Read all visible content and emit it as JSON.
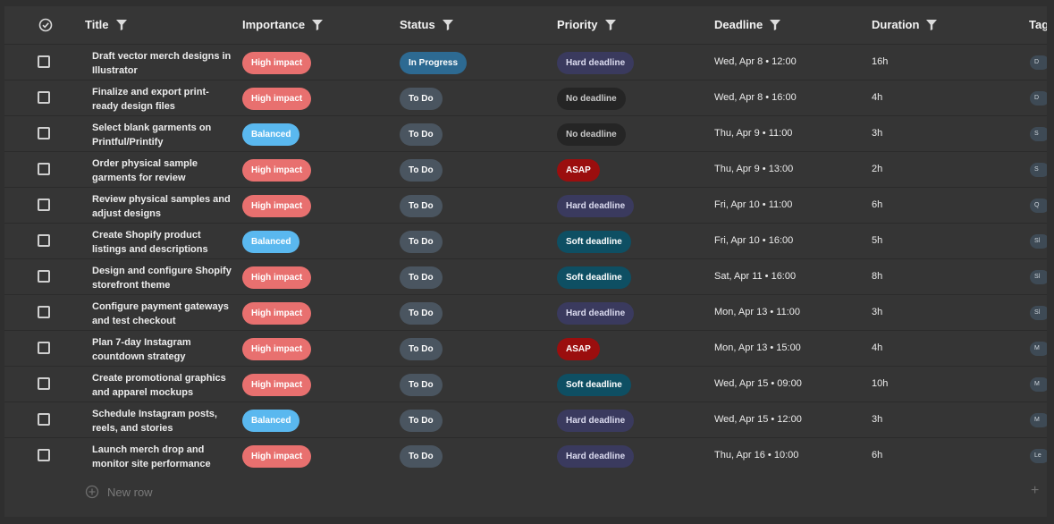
{
  "headers": {
    "title": "Title",
    "importance": "Importance",
    "status": "Status",
    "priority": "Priority",
    "deadline": "Deadline",
    "duration": "Duration",
    "tags": "Tag"
  },
  "colors": {
    "high_impact": "#e8706f",
    "balanced": "#5ab8ef",
    "in_progress": "#2d6a92",
    "to_do": "#4a5560",
    "hard_deadline": "#3a3a5e",
    "no_deadline": "#252525",
    "asap": "#9b0e0e",
    "soft_deadline": "#0e4f63"
  },
  "rows": [
    {
      "title": "Draft vector merch designs in Illustrator",
      "importance": "High impact",
      "status": "In Progress",
      "priority": "Hard deadline",
      "deadline": "Wed, Apr 8 • 12:00",
      "duration": "16h",
      "tag": "D"
    },
    {
      "title": "Finalize and export print-ready design files",
      "importance": "High impact",
      "status": "To Do",
      "priority": "No deadline",
      "deadline": "Wed, Apr 8 • 16:00",
      "duration": "4h",
      "tag": "D"
    },
    {
      "title": "Select blank garments on Printful/Printify",
      "importance": "Balanced",
      "status": "To Do",
      "priority": "No deadline",
      "deadline": "Thu, Apr 9 • 11:00",
      "duration": "3h",
      "tag": "S"
    },
    {
      "title": "Order physical sample garments for review",
      "importance": "High impact",
      "status": "To Do",
      "priority": "ASAP",
      "deadline": "Thu, Apr 9 • 13:00",
      "duration": "2h",
      "tag": "S"
    },
    {
      "title": "Review physical samples and adjust designs",
      "importance": "High impact",
      "status": "To Do",
      "priority": "Hard deadline",
      "deadline": "Fri, Apr 10 • 11:00",
      "duration": "6h",
      "tag": "Q"
    },
    {
      "title": "Create Shopify product listings and descriptions",
      "importance": "Balanced",
      "status": "To Do",
      "priority": "Soft deadline",
      "deadline": "Fri, Apr 10 • 16:00",
      "duration": "5h",
      "tag": "Sl"
    },
    {
      "title": "Design and configure Shopify storefront theme",
      "importance": "High impact",
      "status": "To Do",
      "priority": "Soft deadline",
      "deadline": "Sat, Apr 11 • 16:00",
      "duration": "8h",
      "tag": "Sl"
    },
    {
      "title": "Configure payment gateways and test checkout",
      "importance": "High impact",
      "status": "To Do",
      "priority": "Hard deadline",
      "deadline": "Mon, Apr 13 • 11:00",
      "duration": "3h",
      "tag": "Sl"
    },
    {
      "title": "Plan 7-day Instagram countdown strategy",
      "importance": "High impact",
      "status": "To Do",
      "priority": "ASAP",
      "deadline": "Mon, Apr 13 • 15:00",
      "duration": "4h",
      "tag": "M"
    },
    {
      "title": "Create promotional graphics and apparel mockups",
      "importance": "High impact",
      "status": "To Do",
      "priority": "Soft deadline",
      "deadline": "Wed, Apr 15 • 09:00",
      "duration": "10h",
      "tag": "M"
    },
    {
      "title": "Schedule Instagram posts, reels, and stories",
      "importance": "Balanced",
      "status": "To Do",
      "priority": "Hard deadline",
      "deadline": "Wed, Apr 15 • 12:00",
      "duration": "3h",
      "tag": "M"
    },
    {
      "title": "Launch merch drop and monitor site performance",
      "importance": "High impact",
      "status": "To Do",
      "priority": "Hard deadline",
      "deadline": "Thu, Apr 16 • 10:00",
      "duration": "6h",
      "tag": "Le"
    }
  ],
  "new_row_label": "New row",
  "icons": {
    "select_all": "check-circle-icon",
    "filter": "filter-icon",
    "new_row": "plus-circle-icon",
    "add_column": "plus-icon"
  }
}
